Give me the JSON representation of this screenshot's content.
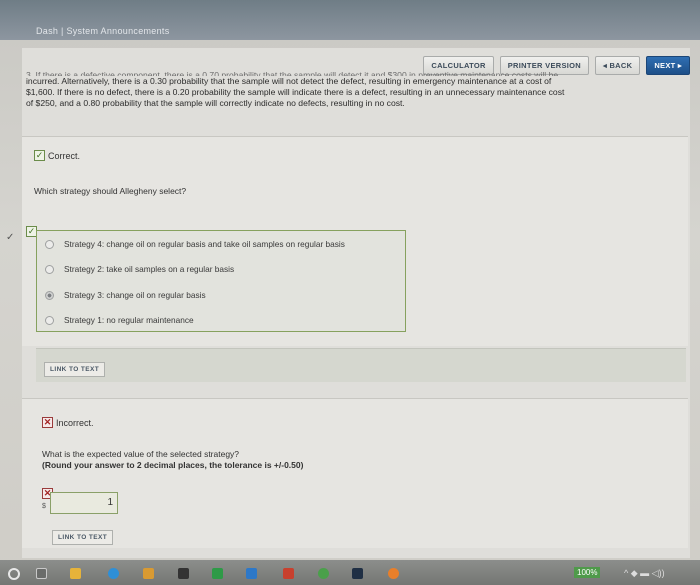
{
  "header": {
    "crumb": "Dash | System Announcements"
  },
  "toolbar": {
    "calculator": "CALCULATOR",
    "printer": "PRINTER VERSION",
    "back": "◂ BACK",
    "next": "NEXT ▸"
  },
  "problem": {
    "cut_line": "3. If there is a defective component, there is a 0.70 probability that the sample will detect it and $300 in preventive maintenance costs will be",
    "line1": "incurred. Alternatively, there is a 0.30 probability that the sample will not detect the defect, resulting in emergency maintenance at a cost of",
    "line2": "$1,600. If there is no defect, there is a 0.20 probability the sample will indicate there is a defect, resulting in an unnecessary maintenance cost",
    "line3": "of $250, and a 0.80 probability that the sample will correctly indicate no defects, resulting in no cost."
  },
  "part1": {
    "status": "Correct.",
    "question": "Which strategy should Allegheny select?",
    "options": [
      {
        "label": "Strategy 4: change oil on regular basis and take oil samples on regular basis",
        "selected": false
      },
      {
        "label": "Strategy 2: take oil samples on a regular basis",
        "selected": false
      },
      {
        "label": "Strategy 3: change oil on regular basis",
        "selected": true
      },
      {
        "label": "Strategy 1: no regular maintenance",
        "selected": false
      }
    ],
    "link": "LINK TO TEXT"
  },
  "part2": {
    "status": "Incorrect.",
    "question": "What is the expected value of the selected strategy?",
    "instruction": "(Round your answer to 2 decimal places, the tolerance is +/-0.50)",
    "currency": "$",
    "answer_value": "1",
    "link": "LINK TO TEXT"
  },
  "taskbar": {
    "zoom": "100%"
  }
}
